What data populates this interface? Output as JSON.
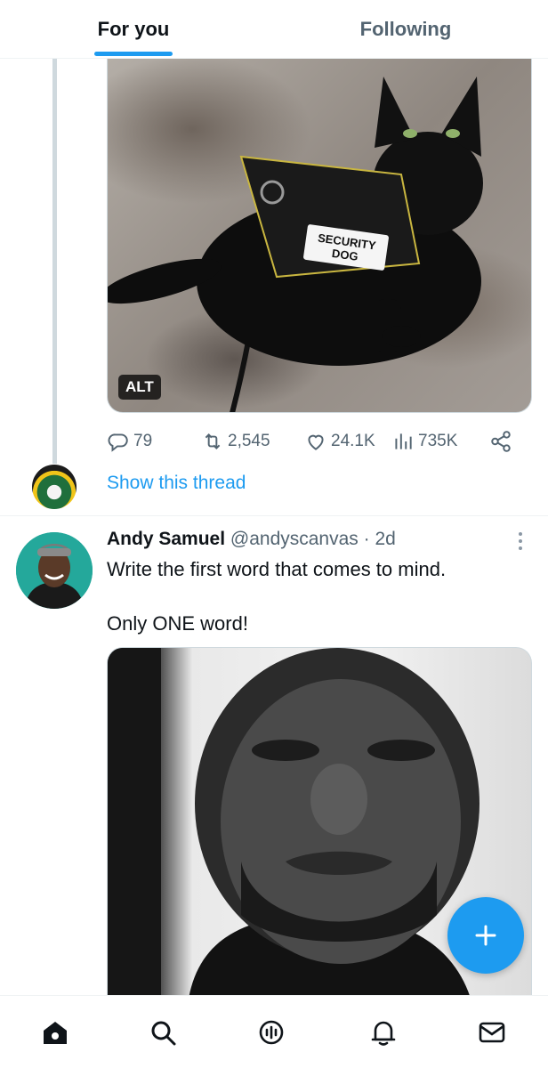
{
  "tabs": {
    "for_you": "For you",
    "following": "Following"
  },
  "tweet1": {
    "image_alt_badge": "ALT",
    "actions": {
      "replies": "79",
      "retweets": "2,545",
      "likes": "24.1K",
      "views": "735K"
    },
    "show_thread": "Show this thread",
    "image_text": "SECURITY DOG"
  },
  "tweet2": {
    "author_name": "Andy Samuel",
    "author_handle": "@andyscanvas",
    "time": "· 2d",
    "text_line1": "Write the first word that comes to mind.",
    "text_line2": "Only ONE word!"
  },
  "colors": {
    "accent": "#1d9bf0",
    "text_primary": "#0f1419",
    "text_secondary": "#536471",
    "border": "#eff3f4"
  },
  "icons": {
    "reply": "reply-icon",
    "retweet": "retweet-icon",
    "like": "heart-icon",
    "views": "views-icon",
    "share": "share-icon",
    "more": "more-icon",
    "compose": "plus-icon",
    "nav": [
      "home-icon",
      "search-icon",
      "spaces-icon",
      "notifications-icon",
      "messages-icon"
    ]
  }
}
